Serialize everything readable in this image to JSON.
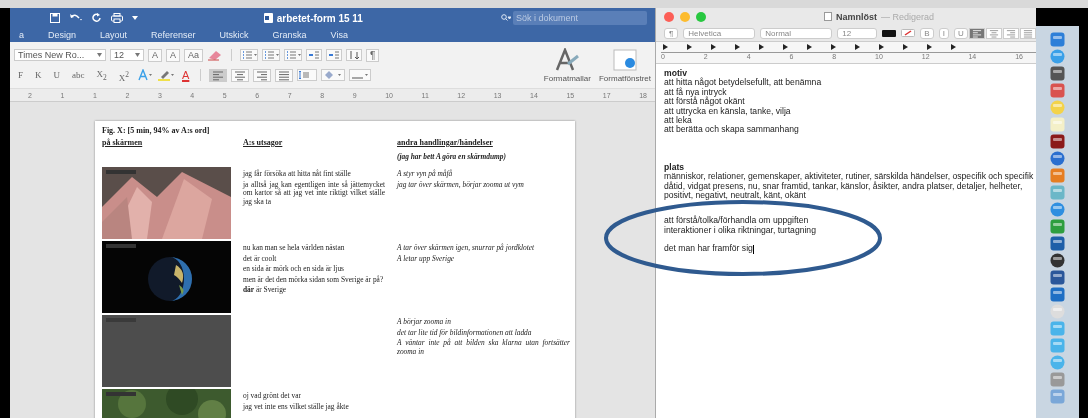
{
  "word": {
    "title": "arbetet-form 15 11",
    "search": {
      "placeholder": "Sök i dokument"
    },
    "tabs": [
      {
        "label": "a",
        "selected": false
      },
      {
        "label": "Design",
        "selected": false
      },
      {
        "label": "Layout",
        "selected": false
      },
      {
        "label": "Referenser",
        "selected": false
      },
      {
        "label": "Utskick",
        "selected": false
      },
      {
        "label": "Granska",
        "selected": false
      },
      {
        "label": "Visa",
        "selected": false
      }
    ],
    "font": {
      "value": "Times New Ro..."
    },
    "size": {
      "value": "12"
    },
    "size_buttons": [
      "A",
      "A",
      "Aa"
    ],
    "format_buttons": [
      "F",
      "K",
      "U",
      "abc",
      "X$_{2}$",
      "X$^{2}$"
    ],
    "font_color": "A",
    "pilcrow": "¶",
    "align_buttons": [
      {
        "kind": "left",
        "selected": true
      },
      {
        "kind": "center",
        "selected": false
      },
      {
        "kind": "right",
        "selected": false
      },
      {
        "kind": "justify",
        "selected": false
      }
    ],
    "styles": [
      {
        "kind": "gallery",
        "label": "Formatmallar"
      },
      {
        "kind": "pane",
        "label": "Formatfönstret"
      }
    ],
    "ruler": [
      "2",
      "1",
      "1",
      "2",
      "3",
      "4",
      "5",
      "6",
      "7",
      "8",
      "9",
      "10",
      "11",
      "12",
      "13",
      "14",
      "15",
      "17",
      "18"
    ],
    "document": {
      "caption": "Fig. X: [5 min, 94% av A:s ord]",
      "columns": [
        "på skärmen",
        "A:s utsagor",
        "andra handlingar/händelser"
      ],
      "note": "(jag har bett A göra en skärmdump)",
      "rows": [
        {
          "utterances": [
            "jag får försöka att hitta nåt fint ställe",
            "ja alltså jag kan egentligen inte så jättemycket om kartor så att jag vet inte riktigt vilket ställe jag ska ta"
          ],
          "actions": [
            "A styr vyn på måfå",
            "jag tar över skärmen, börjar zooma ut vym"
          ]
        },
        {
          "utterances": [
            "nu kan man se hela världen nästan",
            "det är coolt",
            "en sida är mörk och en sida är ljus",
            "men är det den mörka sidan som Sverige är på?",
            "**där** är Sverige"
          ],
          "actions": [
            "A tar över skärmen igen, snurrar på jordklotet",
            "A letar upp Sverige"
          ]
        },
        {
          "actions": [
            "A börjar zooma in",
            "det tar lite tid för bildinformationen att ladda",
            "A väntar inte på att bilden ska klarna utan fortsätter zooma in"
          ]
        },
        {
          "utterances": [
            "oj vad grönt det var",
            "jag vet inte ens vilket ställe jag åkte"
          ]
        }
      ]
    }
  },
  "textedit": {
    "title": "Namnlöst",
    "status": "— Redigerad",
    "paragraph_menu": "¶",
    "font": "Helvetica",
    "style": "Normal",
    "size": "12",
    "format_buttons": [
      "B",
      "I",
      "U"
    ],
    "align_buttons": [
      {
        "kind": "left",
        "selected": true
      },
      {
        "kind": "center",
        "selected": false
      },
      {
        "kind": "right",
        "selected": false
      },
      {
        "kind": "justify",
        "selected": false
      }
    ],
    "ruler": [
      "0",
      "2",
      "4",
      "6",
      "8",
      "10",
      "12",
      "14",
      "16"
    ],
    "blocks": [
      {
        "heading": "motiv",
        "lines": [
          "att hitta något betydelsefullt, att benämna",
          "att få nya intryck",
          "att förstå något okänt",
          "att uttrycka en känsla, tanke, vilja",
          "att leka",
          "att berätta och skapa sammanhang"
        ]
      },
      {
        "heading": "plats",
        "lines": [
          "människor, relationer, gemenskaper, aktiviteter, rutiner, särskilda händelser, ospecifik och specifik dåtid, vidgat presens, nu, snar framtid, tankar, känslor, åsikter, andra platser, detaljer, helheter, positivt, negativt, neutralt, känt, okänt"
        ]
      },
      {
        "lines": [
          "att förstå/tolka/förhandla om uppgiften",
          "interaktioner i olika riktningar, turtagning"
        ]
      },
      {
        "lines": [
          "det man har framför sig"
        ]
      }
    ]
  }
}
